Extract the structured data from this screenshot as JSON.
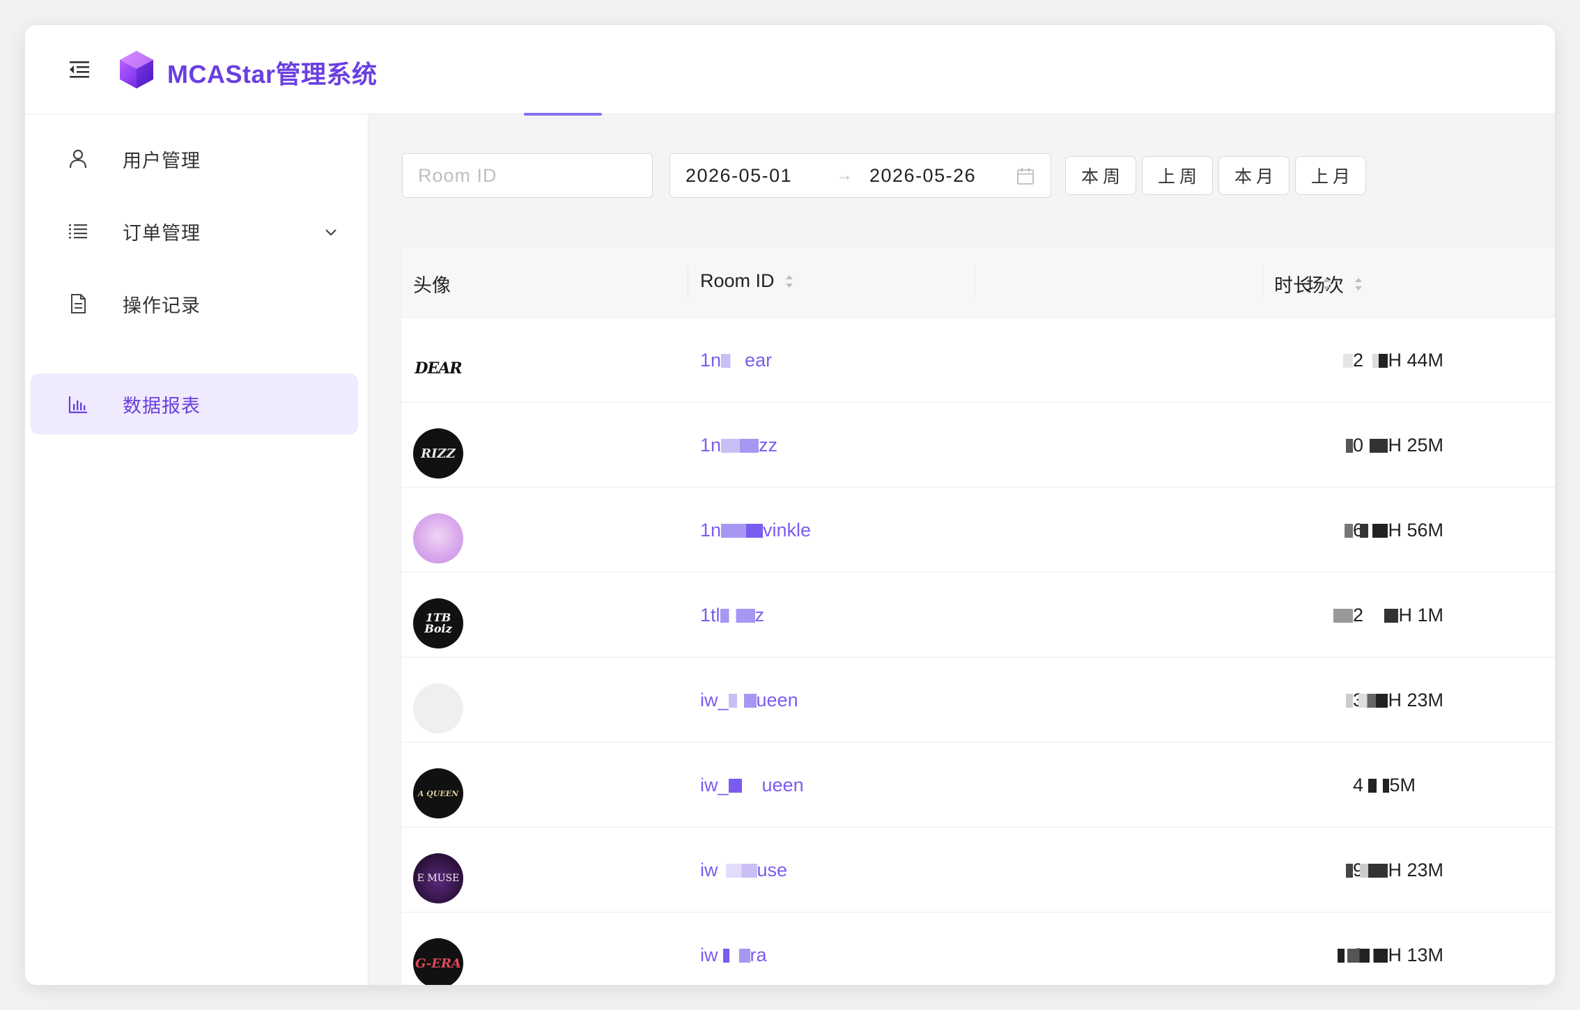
{
  "app": {
    "title": "MCAStar管理系统"
  },
  "colors": {
    "accent": "#6a3fe0",
    "link": "#7b5cf0",
    "active_bg": "#efeafe"
  },
  "sidebar": {
    "items": [
      {
        "label": "用户管理",
        "icon": "user-icon"
      },
      {
        "label": "订单管理",
        "icon": "list-icon",
        "has_submenu": true
      },
      {
        "label": "操作记录",
        "icon": "document-icon"
      },
      {
        "label": "数据报表",
        "icon": "bar-chart-icon",
        "active": true
      }
    ]
  },
  "filters": {
    "room_id_placeholder": "Room ID",
    "date_start": "2026-05-01",
    "date_arrow": "→",
    "date_end": "2026-05-26",
    "quick_buttons": [
      "本周",
      "上周",
      "本月",
      "上月"
    ]
  },
  "table": {
    "columns": {
      "avatar": "头像",
      "room_id": "Room ID",
      "sessions": "场次",
      "duration": "时长"
    },
    "rows": [
      {
        "avatar": "DEAR",
        "room_id": [
          "1n",
          "ear"
        ],
        "sessions": "2",
        "duration": "H 44M"
      },
      {
        "avatar": "RIZZ",
        "room_id": [
          "1n",
          "zz"
        ],
        "sessions": "0",
        "duration": "H 25M"
      },
      {
        "avatar": "",
        "room_id": [
          "1n",
          "vinkle"
        ],
        "sessions": "6",
        "duration": "H 56M"
      },
      {
        "avatar": "1TB Boiz",
        "room_id": [
          "1tl",
          "z"
        ],
        "sessions": "2",
        "duration": "H 1M"
      },
      {
        "avatar": "",
        "room_id": [
          "iw_",
          "ueen"
        ],
        "sessions": "3",
        "duration": "H 23M"
      },
      {
        "avatar": "A QUEEN",
        "room_id": [
          "iw_",
          "ueen"
        ],
        "sessions": "4",
        "duration": "5M"
      },
      {
        "avatar": "E MUSE",
        "room_id": [
          "iw",
          "use"
        ],
        "sessions": "9",
        "duration": "H 23M"
      },
      {
        "avatar": "G-ERA",
        "room_id": [
          "iw",
          "ra"
        ],
        "sessions": "8",
        "duration": "H 13M"
      }
    ]
  }
}
